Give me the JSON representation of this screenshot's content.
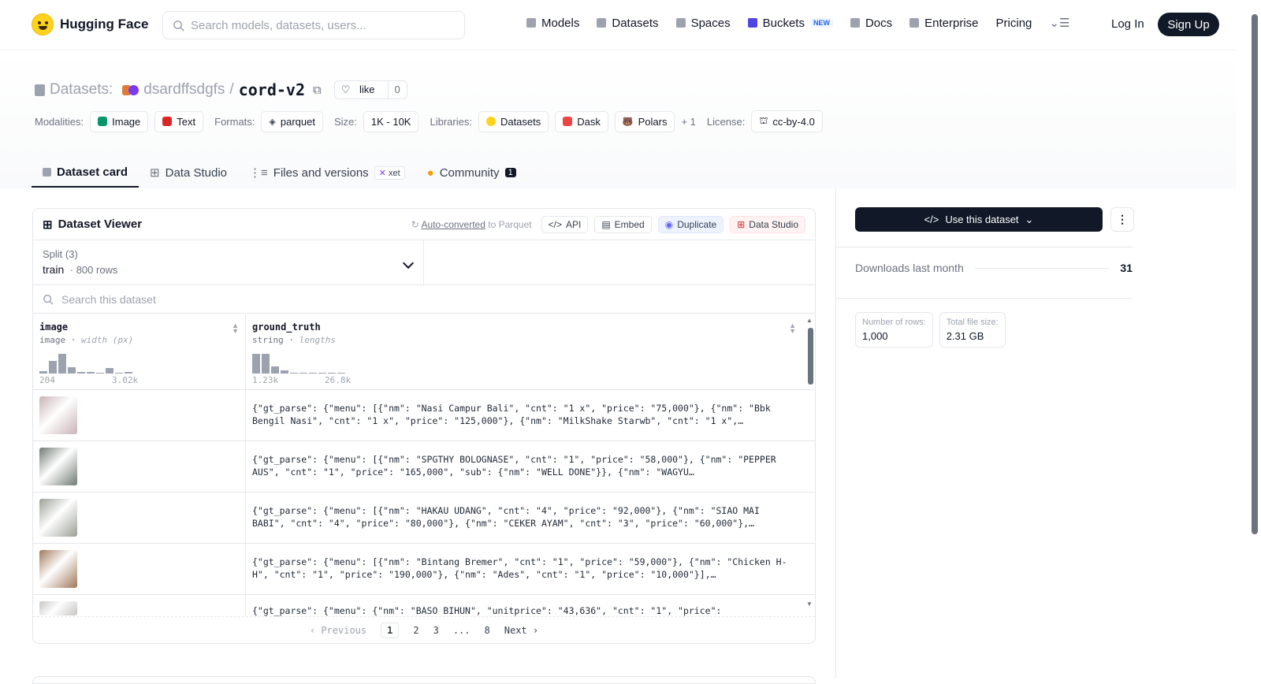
{
  "nav": {
    "logo": "Hugging Face",
    "search_placeholder": "Search models, datasets, users...",
    "items": [
      {
        "label": "Models",
        "icon": "cube-icon"
      },
      {
        "label": "Datasets",
        "icon": "database-icon"
      },
      {
        "label": "Spaces",
        "icon": "grid-icon"
      },
      {
        "label": "Buckets",
        "icon": "bucket-icon",
        "badge": "NEW"
      },
      {
        "label": "Docs",
        "icon": "book-icon"
      },
      {
        "label": "Enterprise",
        "icon": "enterprise-icon"
      },
      {
        "label": "Pricing"
      }
    ],
    "login": "Log In",
    "signup": "Sign Up"
  },
  "header": {
    "prefix": "Datasets:",
    "owner": "dsardffsdgfs",
    "separator": "/",
    "repo": "cord-v2",
    "like_label": "like",
    "like_count": "0",
    "modalities_label": "Modalities:",
    "modalities": [
      "Image",
      "Text"
    ],
    "formats_label": "Formats:",
    "format": "parquet",
    "size_label": "Size:",
    "size": "1K - 10K",
    "libraries_label": "Libraries:",
    "libraries": [
      "Datasets",
      "Dask",
      "Polars"
    ],
    "libraries_more": "+ 1",
    "license_label": "License:",
    "license": "cc-by-4.0"
  },
  "tabs": {
    "card": "Dataset card",
    "studio": "Data Studio",
    "files": "Files and versions",
    "xet": "xet",
    "community": "Community",
    "community_count": "1"
  },
  "viewer": {
    "title": "Dataset Viewer",
    "autoconv_link": "Auto-converted",
    "autoconv_rest": " to Parquet",
    "api": "API",
    "embed": "Embed",
    "duplicate": "Duplicate",
    "data_studio": "Data Studio",
    "split_label": "Split (3)",
    "split_value": "train",
    "split_rows": "800 rows",
    "search_placeholder": "Search this dataset",
    "columns": [
      {
        "name": "image",
        "type": "image",
        "stat": "width (px)",
        "min": "204",
        "max": "3.02k",
        "hist": [
          0.1,
          0.6,
          0.95,
          0.3,
          0.08,
          0.08,
          0,
          0.25,
          0,
          0.06
        ]
      },
      {
        "name": "ground_truth",
        "type": "string",
        "stat": "lengths",
        "min": "1.23k",
        "max": "26.8k",
        "hist": [
          0.95,
          0.95,
          0.35,
          0.15,
          0.05,
          0.05,
          0.05,
          0.05,
          0.05,
          0.05
        ]
      }
    ],
    "rows": [
      {
        "thumb": "#c9b3b5",
        "text": "{\"gt_parse\": {\"menu\": [{\"nm\": \"Nasi Campur Bali\", \"cnt\": \"1 x\", \"price\": \"75,000\"}, {\"nm\": \"Bbk Bengil Nasi\", \"cnt\": \"1 x\", \"price\": \"125,000\"}, {\"nm\": \"MilkShake Starwb\", \"cnt\": \"1 x\",…"
      },
      {
        "thumb": "#6f7a73",
        "text": "{\"gt_parse\": {\"menu\": [{\"nm\": \"SPGTHY BOLOGNASE\", \"cnt\": \"1\", \"price\": \"58,000\"}, {\"nm\": \"PEPPER AUS\", \"cnt\": \"1\", \"price\": \"165,000\", \"sub\": {\"nm\": \"WELL DONE\"}}, {\"nm\": \"WAGYU…"
      },
      {
        "thumb": "#9aa094",
        "text": "{\"gt_parse\": {\"menu\": [{\"nm\": \"HAKAU UDANG\", \"cnt\": \"4\", \"price\": \"92,000\"}, {\"nm\": \"SIAO MAI BABI\", \"cnt\": \"4\", \"price\": \"80,000\"}, {\"nm\": \"CEKER AYAM\", \"cnt\": \"3\", \"price\": \"60,000\"},…"
      },
      {
        "thumb": "#a0785a",
        "text": "{\"gt_parse\": {\"menu\": [{\"nm\": \"Bintang Bremer\", \"cnt\": \"1\", \"price\": \"59,000\"}, {\"nm\": \"Chicken H-H\", \"cnt\": \"1\", \"price\": \"190,000\"}, {\"nm\": \"Ades\", \"cnt\": \"1\", \"price\": \"10,000\"}],…"
      },
      {
        "thumb": "#c8c4c4",
        "text": "{\"gt_parse\": {\"menu\": {\"nm\": \"BASO BIHUN\", \"unitprice\": \"43,636\", \"cnt\": \"1\", \"price\":"
      }
    ],
    "pager": {
      "prev": "Previous",
      "pages": [
        "1",
        "2",
        "3",
        "...",
        "8"
      ],
      "next": "Next"
    }
  },
  "sidebar": {
    "use_button": "Use this dataset",
    "downloads_label": "Downloads last month",
    "downloads_value": "31",
    "rows_label": "Number of rows:",
    "rows_value": "1,000",
    "size_label": "Total file size:",
    "size_value": "2.31 GB"
  }
}
